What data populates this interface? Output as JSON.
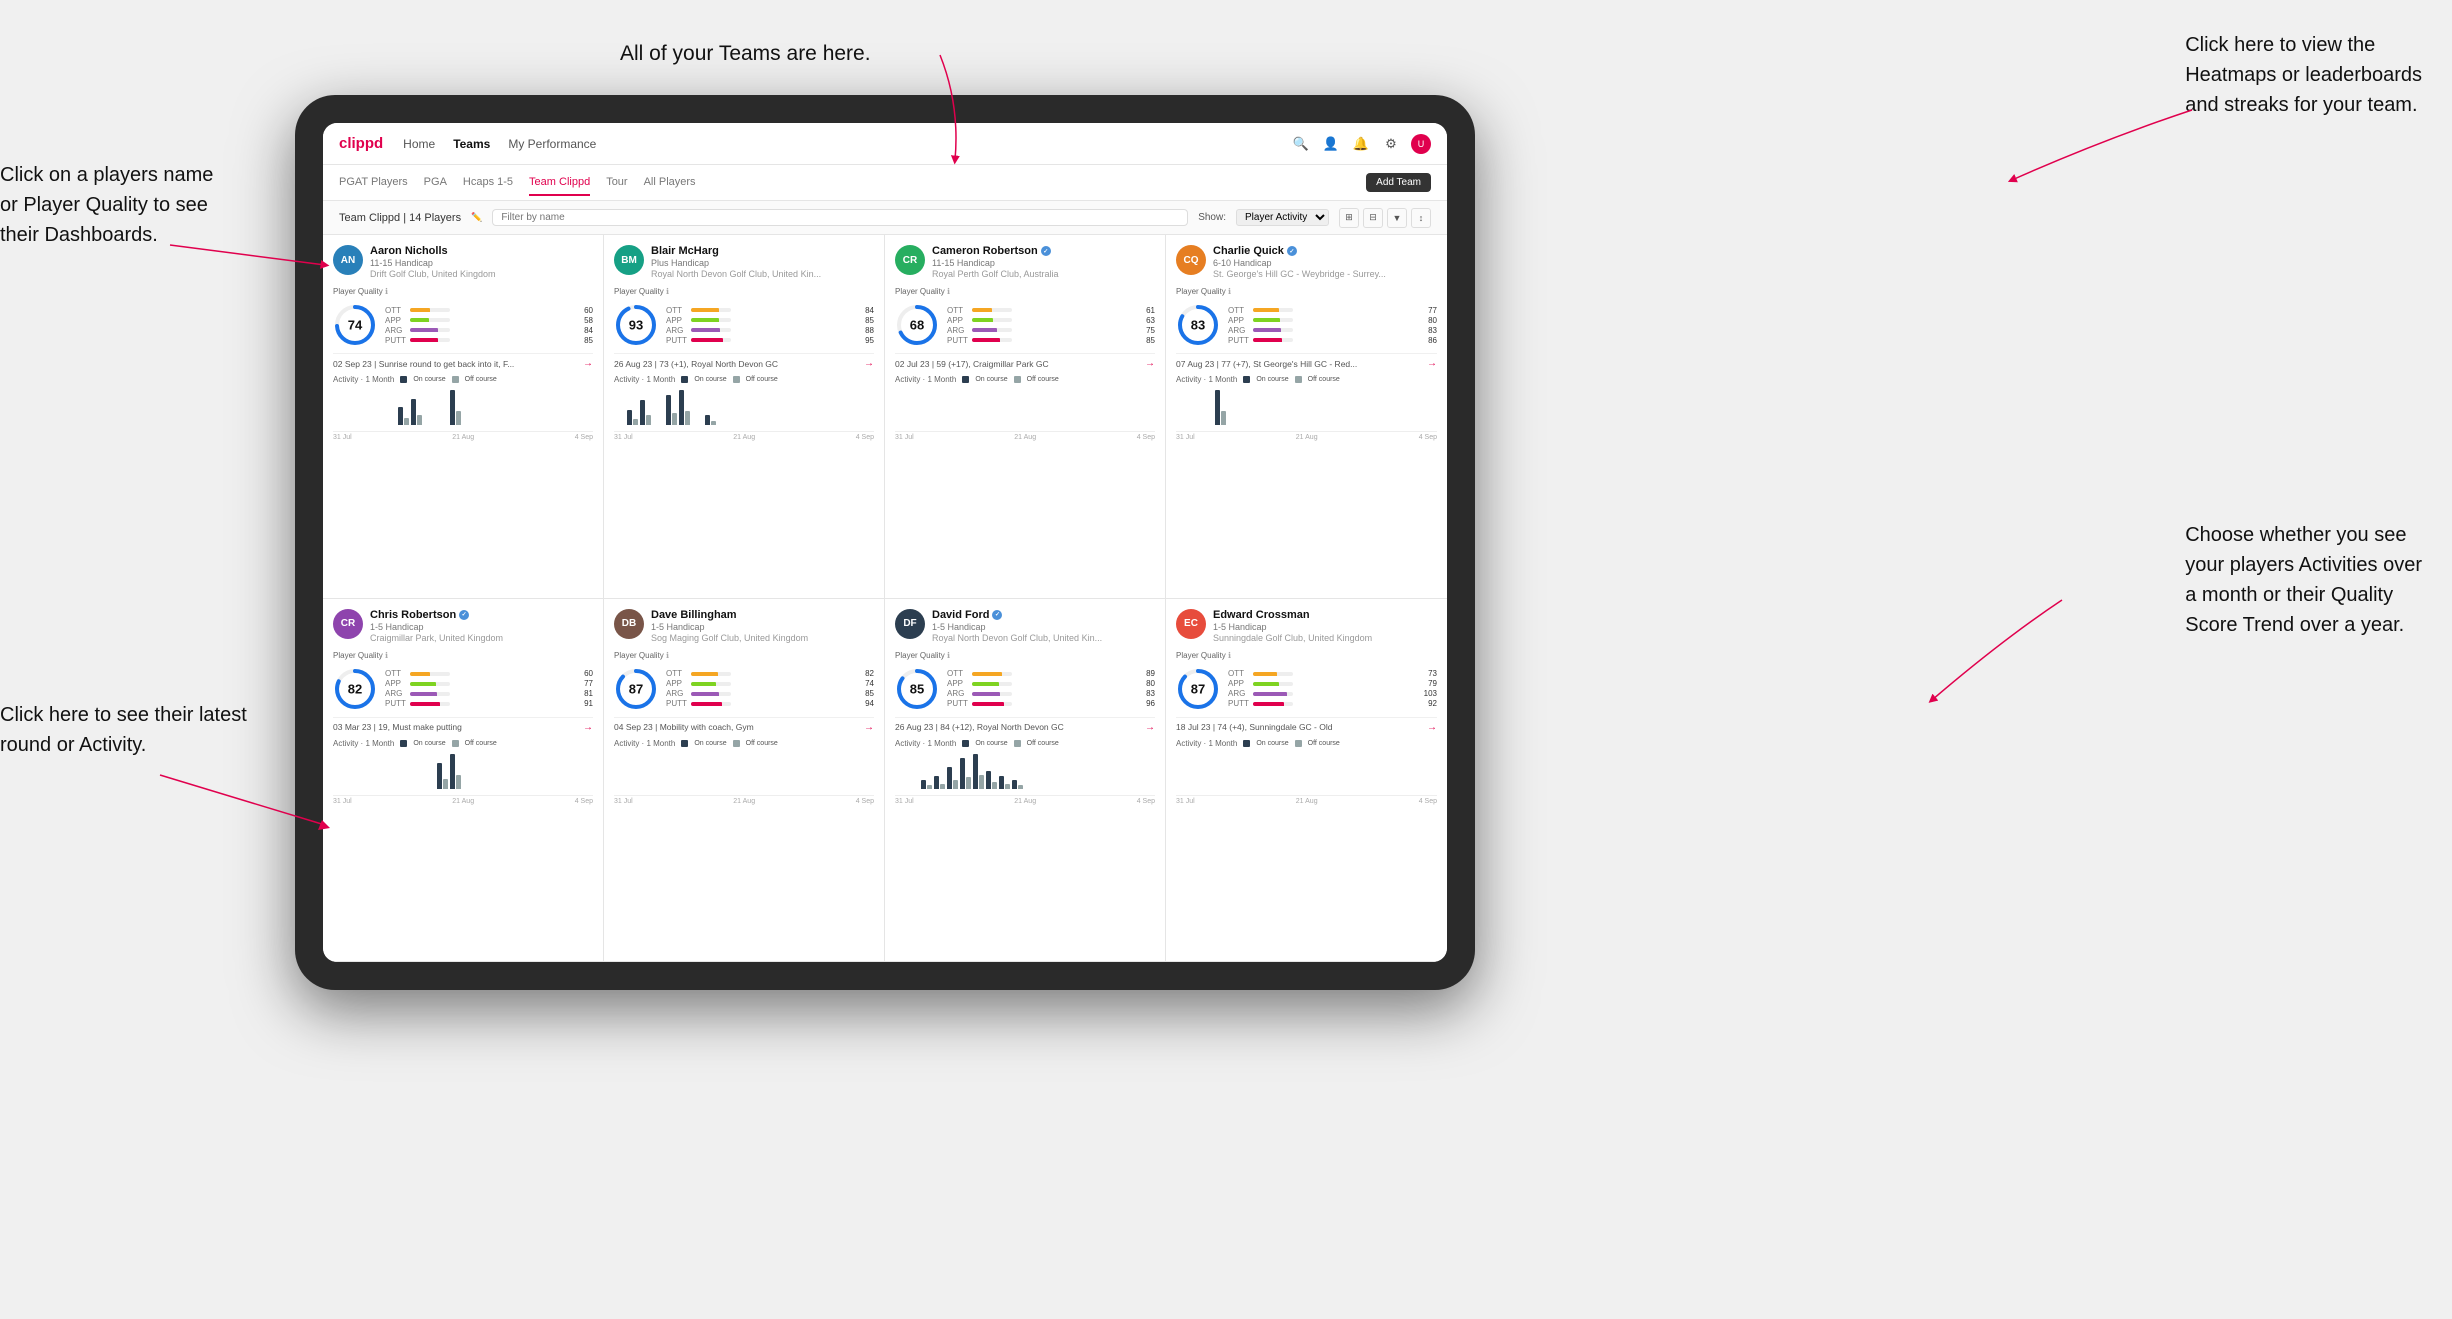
{
  "annotations": {
    "top_center": "All of your Teams are here.",
    "top_right_title": "Click here to view the",
    "top_right_line2": "Heatmaps or leaderboards",
    "top_right_line3": "and streaks for your team.",
    "left_top_title": "Click on a players name",
    "left_top_line2": "or Player Quality to see",
    "left_top_line3": "their Dashboards.",
    "left_bottom_title": "Click here to see their latest",
    "left_bottom_line2": "round or Activity.",
    "right_bottom_title": "Choose whether you see",
    "right_bottom_line2": "your players Activities over",
    "right_bottom_line3": "a month or their Quality",
    "right_bottom_line4": "Score Trend over a year."
  },
  "nav": {
    "logo": "clippd",
    "links": [
      "Home",
      "Teams",
      "My Performance"
    ],
    "active": "Teams"
  },
  "sub_nav": {
    "links": [
      "PGAT Players",
      "PGA",
      "Hcaps 1-5",
      "Team Clippd",
      "Tour",
      "All Players"
    ],
    "active": "Team Clippd",
    "add_team_label": "Add Team"
  },
  "team_bar": {
    "title": "Team Clippd | 14 Players",
    "search_placeholder": "Filter by name",
    "show_label": "Show:",
    "show_value": "Player Activity"
  },
  "players": [
    {
      "name": "Aaron Nicholls",
      "handicap": "11-15 Handicap",
      "club": "Drift Golf Club, United Kingdom",
      "quality": 74,
      "quality_pct": 74,
      "verified": false,
      "color": "avatar-blue",
      "initials": "AN",
      "stats": {
        "ott": 60,
        "app": 58,
        "arg": 84,
        "putt": 85
      },
      "recent": "02 Sep 23 | Sunrise round to get back into it, F...",
      "activity_bars": [
        0,
        0,
        0,
        0,
        0,
        2,
        3,
        0,
        0,
        4,
        0,
        0
      ],
      "chart_dates": [
        "31 Jul",
        "21 Aug",
        "4 Sep"
      ]
    },
    {
      "name": "Blair McHarg",
      "handicap": "Plus Handicap",
      "club": "Royal North Devon Golf Club, United Kin...",
      "quality": 93,
      "quality_pct": 93,
      "verified": false,
      "color": "avatar-teal",
      "initials": "BM",
      "stats": {
        "ott": 84,
        "app": 85,
        "arg": 88,
        "putt": 95
      },
      "recent": "26 Aug 23 | 73 (+1), Royal North Devon GC",
      "activity_bars": [
        0,
        3,
        5,
        0,
        6,
        7,
        0,
        2,
        0,
        0,
        0,
        0
      ],
      "chart_dates": [
        "31 Jul",
        "21 Aug",
        "4 Sep"
      ]
    },
    {
      "name": "Cameron Robertson",
      "handicap": "11-15 Handicap",
      "club": "Royal Perth Golf Club, Australia",
      "quality": 68,
      "quality_pct": 68,
      "verified": true,
      "color": "avatar-green",
      "initials": "CR",
      "stats": {
        "ott": 61,
        "app": 63,
        "arg": 75,
        "putt": 85
      },
      "recent": "02 Jul 23 | 59 (+17), Craigmillar Park GC",
      "activity_bars": [
        0,
        0,
        0,
        0,
        0,
        0,
        0,
        0,
        0,
        0,
        0,
        0
      ],
      "chart_dates": [
        "31 Jul",
        "21 Aug",
        "4 Sep"
      ]
    },
    {
      "name": "Charlie Quick",
      "handicap": "6-10 Handicap",
      "club": "St. George's Hill GC - Weybridge - Surrey...",
      "quality": 83,
      "quality_pct": 83,
      "verified": true,
      "color": "avatar-orange",
      "initials": "CQ",
      "stats": {
        "ott": 77,
        "app": 80,
        "arg": 83,
        "putt": 86
      },
      "recent": "07 Aug 23 | 77 (+7), St George's Hill GC - Red...",
      "activity_bars": [
        0,
        0,
        0,
        2,
        0,
        0,
        0,
        0,
        0,
        0,
        0,
        0
      ],
      "chart_dates": [
        "31 Jul",
        "21 Aug",
        "4 Sep"
      ]
    },
    {
      "name": "Chris Robertson",
      "handicap": "1-5 Handicap",
      "club": "Craigmillar Park, United Kingdom",
      "quality": 82,
      "quality_pct": 82,
      "verified": true,
      "color": "avatar-purple",
      "initials": "CR",
      "stats": {
        "ott": 60,
        "app": 77,
        "arg": 81,
        "putt": 91
      },
      "recent": "03 Mar 23 | 19, Must make putting",
      "activity_bars": [
        0,
        0,
        0,
        0,
        0,
        0,
        0,
        0,
        3,
        4,
        0,
        0
      ],
      "chart_dates": [
        "31 Jul",
        "21 Aug",
        "4 Sep"
      ]
    },
    {
      "name": "Dave Billingham",
      "handicap": "1-5 Handicap",
      "club": "Sog Maging Golf Club, United Kingdom",
      "quality": 87,
      "quality_pct": 87,
      "verified": false,
      "color": "avatar-brown",
      "initials": "DB",
      "stats": {
        "ott": 82,
        "app": 74,
        "arg": 85,
        "putt": 94
      },
      "recent": "04 Sep 23 | Mobility with coach, Gym",
      "activity_bars": [
        0,
        0,
        0,
        0,
        0,
        0,
        0,
        0,
        0,
        0,
        0,
        0
      ],
      "chart_dates": [
        "31 Jul",
        "21 Aug",
        "4 Sep"
      ]
    },
    {
      "name": "David Ford",
      "handicap": "1-5 Handicap",
      "club": "Royal North Devon Golf Club, United Kin...",
      "quality": 85,
      "quality_pct": 85,
      "verified": true,
      "color": "avatar-darkblue",
      "initials": "DF",
      "stats": {
        "ott": 89,
        "app": 80,
        "arg": 83,
        "putt": 96
      },
      "recent": "26 Aug 23 | 84 (+12), Royal North Devon GC",
      "activity_bars": [
        0,
        0,
        2,
        3,
        5,
        7,
        8,
        4,
        3,
        2,
        0,
        0
      ],
      "chart_dates": [
        "31 Jul",
        "21 Aug",
        "4 Sep"
      ]
    },
    {
      "name": "Edward Crossman",
      "handicap": "1-5 Handicap",
      "club": "Sunningdale Golf Club, United Kingdom",
      "quality": 87,
      "quality_pct": 87,
      "verified": false,
      "color": "avatar-red",
      "initials": "EC",
      "stats": {
        "ott": 73,
        "app": 79,
        "arg": 103,
        "putt": 92
      },
      "recent": "18 Jul 23 | 74 (+4), Sunningdale GC - Old",
      "activity_bars": [
        0,
        0,
        0,
        0,
        0,
        0,
        0,
        0,
        0,
        0,
        0,
        0
      ],
      "chart_dates": [
        "31 Jul",
        "21 Aug",
        "4 Sep"
      ]
    }
  ],
  "activity_legend": {
    "label": "Activity · 1 Month",
    "on_course": "On course",
    "off_course": "Off course"
  }
}
